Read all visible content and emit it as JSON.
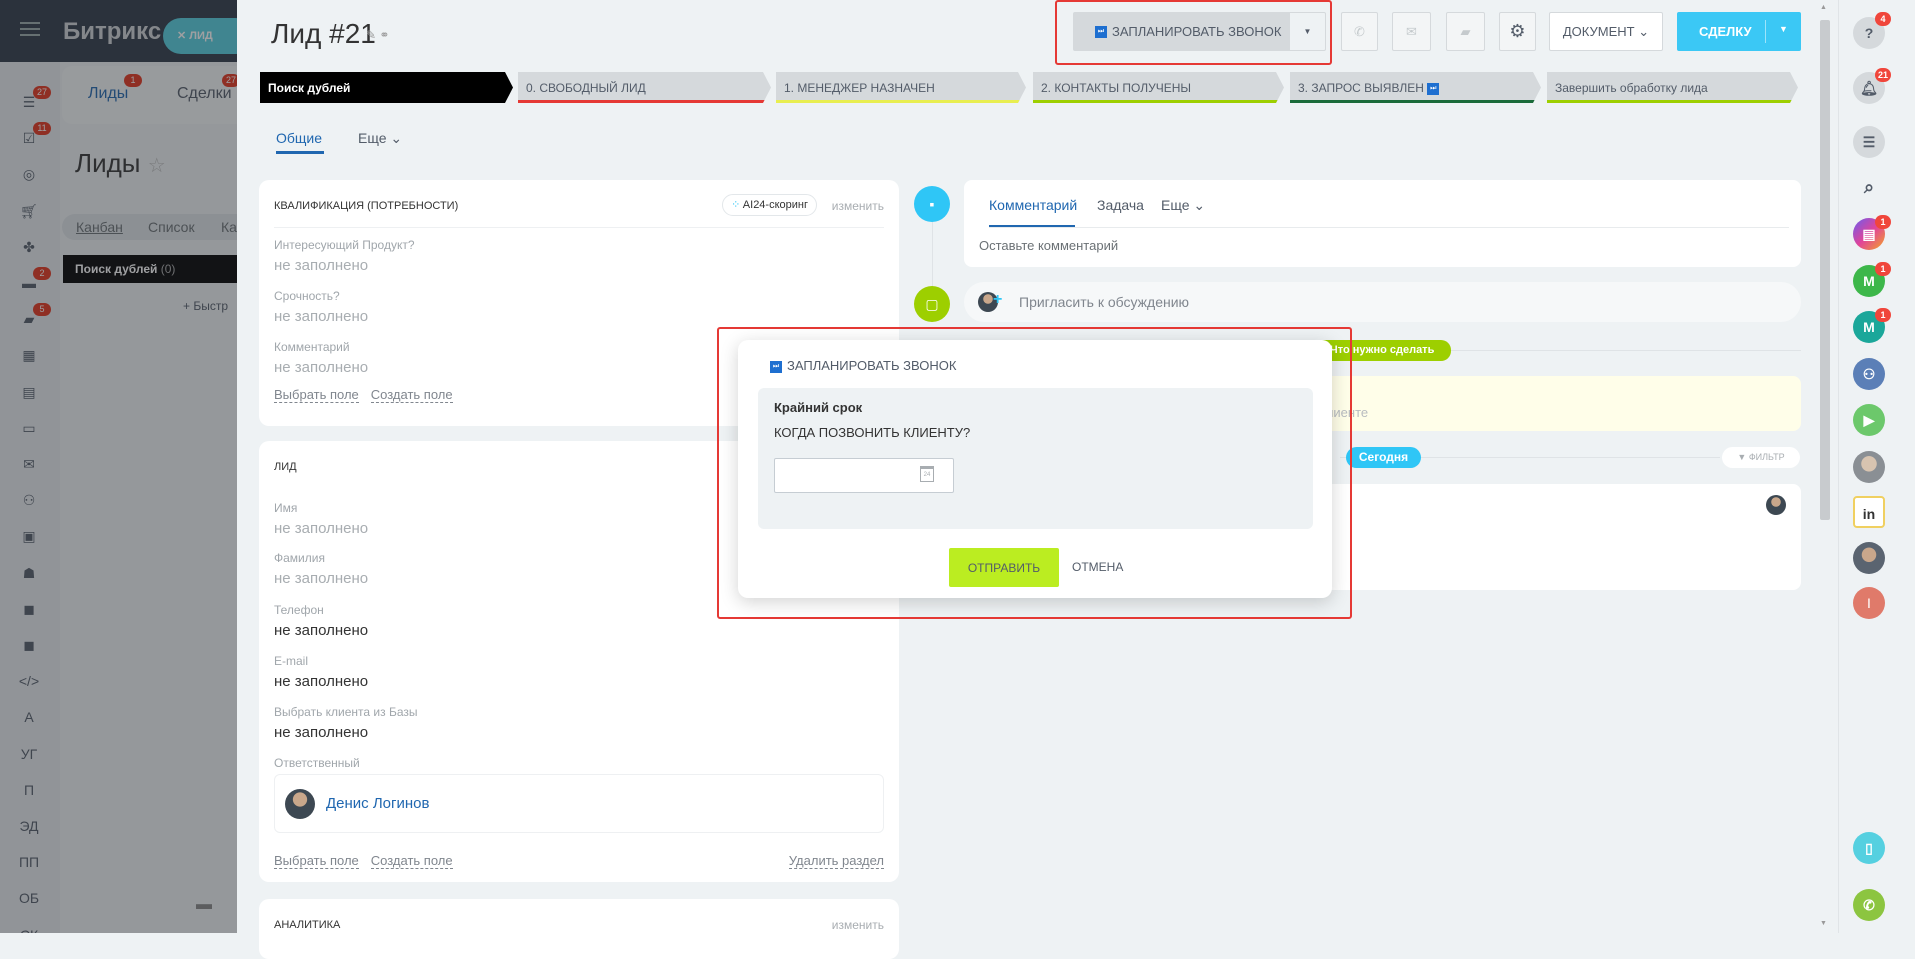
{
  "underlying": {
    "logo": "Битрикс",
    "active_pill": "ЛИД",
    "tabs": [
      {
        "label": "Лиды",
        "badge": "1"
      },
      {
        "label": "Сделки",
        "badge": "27"
      }
    ],
    "page_title": "Лиды",
    "view_tabs": [
      "Канбан",
      "Список",
      "Ка"
    ],
    "column": {
      "name": "Поиск дублей",
      "count": "(0)"
    },
    "quick_add": "+ Быстр",
    "left_menu": [
      {
        "icon": "filter",
        "badge": "27"
      },
      {
        "icon": "tasks",
        "badge": "11"
      },
      {
        "icon": "target"
      },
      {
        "icon": "cart"
      },
      {
        "icon": "puzzle"
      },
      {
        "icon": "card",
        "badge": "2"
      },
      {
        "icon": "chat",
        "badge": "5"
      },
      {
        "icon": "calendar"
      },
      {
        "icon": "document"
      },
      {
        "icon": "drive"
      },
      {
        "icon": "mail"
      },
      {
        "icon": "people"
      },
      {
        "icon": "contact"
      },
      {
        "icon": "robot"
      },
      {
        "icon": "box"
      },
      {
        "icon": "box"
      },
      {
        "icon": "code",
        "label": "</>"
      },
      {
        "label": "А"
      },
      {
        "label": "УГ"
      },
      {
        "label": "П"
      },
      {
        "label": "ЭД"
      },
      {
        "label": "ПП"
      },
      {
        "label": "ОБ"
      },
      {
        "label": "СК"
      }
    ]
  },
  "header": {
    "title": "Лид #21",
    "schedule_call": "ЗАПЛАНИРОВАТЬ ЗВОНОК",
    "document": "ДОКУМЕНТ",
    "deal": "СДЕЛКУ"
  },
  "stages": [
    {
      "label": "Поиск дублей",
      "color": "#000000"
    },
    {
      "label": "0. СВОБОДНЫЙ ЛИД",
      "color": "#e53935"
    },
    {
      "label": "1. МЕНЕДЖЕР НАЗНАЧЕН",
      "color": "#e8ee50"
    },
    {
      "label": "2. КОНТАКТЫ ПОЛУЧЕНЫ",
      "color": "#9dcf00"
    },
    {
      "label": "3. ЗАПРОС ВЫЯВЛЕН",
      "color": "#1a6b3a"
    },
    {
      "label": "Завершить обработку лида",
      "color": "#9dcf00"
    }
  ],
  "tabs": {
    "general": "Общие",
    "more": "Еще"
  },
  "qualification": {
    "title": "КВАЛИФИКАЦИЯ (ПОТРЕБНОСТИ)",
    "ai_chip": "AI24-скоринг",
    "edit": "изменить",
    "fields": [
      {
        "label": "Интересующий Продукт?",
        "value": "не заполнено"
      },
      {
        "label": "Срочность?",
        "value": "не заполнено"
      },
      {
        "label": "Комментарий",
        "value": "не заполнено"
      }
    ],
    "select_field": "Выбрать поле",
    "create_field": "Создать поле"
  },
  "lead": {
    "title": "ЛИД",
    "fields": [
      {
        "label": "Имя",
        "value": "не заполнено"
      },
      {
        "label": "Фамилия",
        "value": "не заполнено"
      },
      {
        "label": "Телефон",
        "value": "не заполнено"
      },
      {
        "label": "E-mail",
        "value": "не заполнено"
      },
      {
        "label": "Выбрать клиента из Базы",
        "value": "не заполнено"
      }
    ],
    "responsible_label": "Ответственный",
    "responsible_name": "Денис Логинов",
    "select_field": "Выбрать поле",
    "create_field": "Создать поле",
    "delete_section": "Удалить раздел"
  },
  "analytics": {
    "title": "АНАЛИТИКА",
    "edit": "изменить"
  },
  "timeline": {
    "tabs": [
      "Комментарий",
      "Задача",
      "Еще"
    ],
    "comment_placeholder": "Оставьте комментарий",
    "invite": "Пригласить к обсуждению",
    "todo_pill": "Что нужно сделать",
    "todo_text": "клиенте",
    "today": "Сегодня",
    "filter": "ФИЛЬТР"
  },
  "modal": {
    "title": "ЗАПЛАНИРОВАТЬ ЗВОНОК",
    "deadline_label": "Крайний срок",
    "question": "КОГДА ПОЗВОНИТЬ КЛИЕНТУ?",
    "date_value": "",
    "calendar_day": "24",
    "send": "ОТПРАВИТЬ",
    "cancel": "ОТМЕНА"
  },
  "right_rail": [
    {
      "icon": "help",
      "badge": "4",
      "color": "#d5d9dc"
    },
    {
      "icon": "bell",
      "badge": "21",
      "color": "#d5d9dc"
    },
    {
      "icon": "chat-list",
      "color": "#d5d9dc"
    },
    {
      "icon": "search"
    },
    {
      "icon": "open-lines",
      "badge": "1",
      "color": "#8f5fe0"
    },
    {
      "icon": "chat-m",
      "label": "M",
      "badge": "1",
      "color": "#3db74a"
    },
    {
      "icon": "chat-m",
      "label": "M",
      "badge": "1",
      "color": "#1ba79a"
    },
    {
      "icon": "group",
      "color": "#5b7fb7"
    },
    {
      "icon": "video",
      "color": "#6cc86b"
    },
    {
      "icon": "user-avatar",
      "color": "#9a9ea2"
    },
    {
      "icon": "in-logo",
      "label": "in",
      "color": "#ffffff"
    },
    {
      "icon": "user-avatar",
      "color": "#7b8085"
    },
    {
      "icon": "user-initial",
      "label": "I",
      "color": "#e07a6a"
    }
  ]
}
